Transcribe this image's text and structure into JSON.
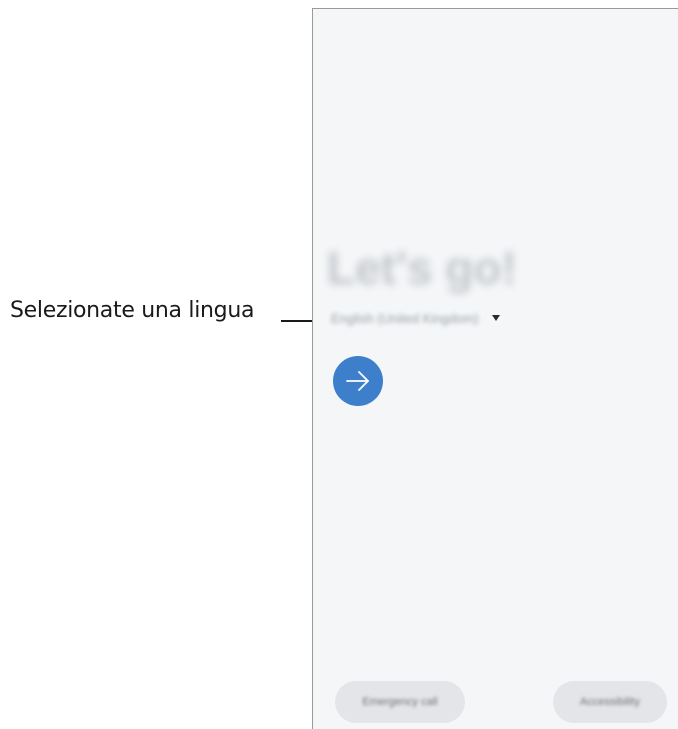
{
  "annotation": {
    "label": "Selezionate una lingua"
  },
  "welcome": {
    "title": "Let's go!",
    "language_value": "English (United Kingdom)"
  },
  "icons": {
    "next": "arrow-right-icon",
    "dropdown": "dropdown-triangle-icon"
  },
  "footer": {
    "emergency_call_label": "Emergency call",
    "accessibility_label": "Accessibility"
  },
  "colors": {
    "accent": "#3d7fcb",
    "screen_background": "#f4f6f8",
    "button_background": "#e3e5e8"
  }
}
